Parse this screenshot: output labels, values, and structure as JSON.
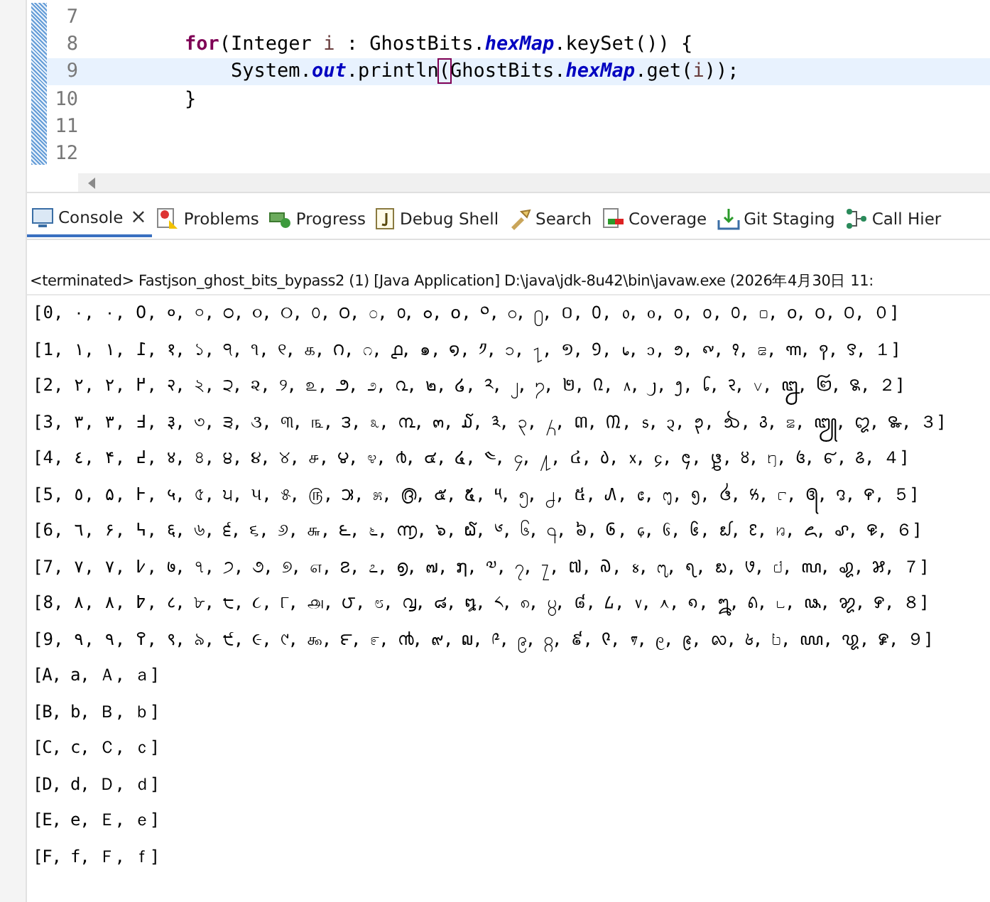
{
  "editor": {
    "lines": [
      {
        "number": "7",
        "highlighted": false
      },
      {
        "number": "8",
        "highlighted": false,
        "tokens": [
          {
            "text": "        for",
            "kind": "keyword"
          },
          {
            "text": "(Integer ",
            "kind": "plain"
          },
          {
            "text": "i",
            "kind": "local"
          },
          {
            "text": " : GhostBits.",
            "kind": "plain"
          },
          {
            "text": "hexMap",
            "kind": "static"
          },
          {
            "text": ".keySet()) {",
            "kind": "plain"
          }
        ]
      },
      {
        "number": "9",
        "highlighted": true,
        "tokens": [
          {
            "text": "            System.",
            "kind": "plain"
          },
          {
            "text": "out",
            "kind": "static"
          },
          {
            "text": ".println",
            "kind": "plain"
          },
          {
            "text": "(",
            "kind": "bracket"
          },
          {
            "text": "GhostBits.",
            "kind": "plain"
          },
          {
            "text": "hexMap",
            "kind": "static"
          },
          {
            "text": ".get(",
            "kind": "plain"
          },
          {
            "text": "i",
            "kind": "local"
          },
          {
            "text": "));",
            "kind": "plain"
          }
        ]
      },
      {
        "number": "10",
        "highlighted": false,
        "tokens": [
          {
            "text": "        }",
            "kind": "plain"
          }
        ]
      },
      {
        "number": "11",
        "highlighted": false
      },
      {
        "number": "12",
        "highlighted": false
      }
    ]
  },
  "tabs": [
    {
      "label": "Console",
      "selected": true,
      "close": "×"
    },
    {
      "label": "Problems",
      "selected": false
    },
    {
      "label": "Progress",
      "selected": false
    },
    {
      "label": "Debug Shell",
      "selected": false
    },
    {
      "label": "Search",
      "selected": false
    },
    {
      "label": "Coverage",
      "selected": false
    },
    {
      "label": "Git Staging",
      "selected": false
    },
    {
      "label": "Call Hier",
      "selected": false
    }
  ],
  "console": {
    "status": "<terminated> Fastjson_ghost_bits_bypass2 (1) [Java Application] D:\\java\\jdk-8u42\\bin\\javaw.exe  (2026年4月30日 11:",
    "lines": [
      "[0, ٠, ۰, ߀, ०, ০, ੦, ૦, ୦, ௦, ౦, ೦, ൦, ๐, ໐, ༠, ၀, ႐, ០, ᠐, ᥆, ᧐, ᪀, ᪐, ꣐, ꤀, ꧐, ꩐, ꯰, ０]",
      "[1, ١, ۱, ߁, १, ১, ੧, ૧, ୧, ௧, ౧, ೧, ൧, ๑, ໑, ༡, ၁, ႑, ១, ᠑, ᥇, ᧑, ᪁, ᪑, ꣑, ꤁, ꧑, ꩑, ꯱, １]",
      "[2, ٢, ۲, ߂, २, ২, ੨, ૨, ୨, ௨, ౨, ೨, ൨, ๒, ໒, ༢, ၂, ႒, ២, ᠒, ᥈, ᧒, ᪂, ᪒, ꣒, ꤂, ꧒, ꩒, ꯲, ２]",
      "[3, ٣, ۳, ߃, ३, ৩, ੩, ૩, ୩, ௩, ౩, ೩, ൩, ๓, ໓, ༣, ၃, ႓, ៣, ᠓, ᥉, ᧓, ᪃, ᪓, ꣓, ꤃, ꧓, ꩓, ꯳, ３]",
      "[4, ٤, ۴, ߄, ४, ৪, ੪, ૪, ୪, ௪, ౪, ೪, ൪, ๔, ໔, ༤, ၄, ႔, ៤, ᠔, ᥊, ᧔, ᪄, ᪔, ꣔, ꤄, ꧔, ꩔, ꯴, ４]",
      "[5, ٥, ۵, ߅, ५, ৫, ੫, ૫, ୫, ௫, ౫, ೫, ൫, ๕, ໕, ༥, ၅, ႕, ៥, ᠕, ᥋, ᧕, ᪅, ᪕, ꣕, ꤅, ꧕, ꩕, ꯵, ５]",
      "[6, ٦, ۶, ߆, ६, ৬, ੬, ૬, ୬, ௬, ౬, ೬, ൬, ๖, ໖, ༦, ၆, ႖, ៦, ᠖, ᥌, ᧖, ᪆, ᪖, ꣖, ꤆, ꧖, ꩖, ꯶, ６]",
      "[7, ٧, ۷, ߇, ७, ৭, ੭, ૭, ୭, ௭, ౭, ೭, ൭, ๗, ໗, ༧, ၇, ႗, ៧, ᠗, ᥍, ᧗, ᪇, ᪗, ꣗, ꤇, ꧗, ꩗, ꯷, ７]",
      "[8, ٨, ۸, ߈, ८, ৮, ੮, ૮, ୮, ௮, ౮, ೮, ൮, ๘, ໘, ༨, ၈, ႘, ៨, ᠘, ᥎, ᧘, ᪈, ᪘, ꣘, ꤈, ꧘, ꩘, ꯸, ８]",
      "[9, ٩, ۹, ߉, ९, ৯, ੯, ૯, ୯, ௯, ౯, ೯, ൯, ๙, ໙, ༩, ၉, ႙, ៩, ᠙, ᥏, ᧙, ᪉, ᪙, ꣙, ꤉, ꧙, ꩙, ꯹, ９]",
      "[A, a, Ａ, ａ]",
      "[B, b, Ｂ, ｂ]",
      "[C, c, Ｃ, ｃ]",
      "[D, d, Ｄ, ｄ]",
      "[E, e, Ｅ, ｅ]",
      "[F, f, Ｆ, ｆ]"
    ]
  }
}
